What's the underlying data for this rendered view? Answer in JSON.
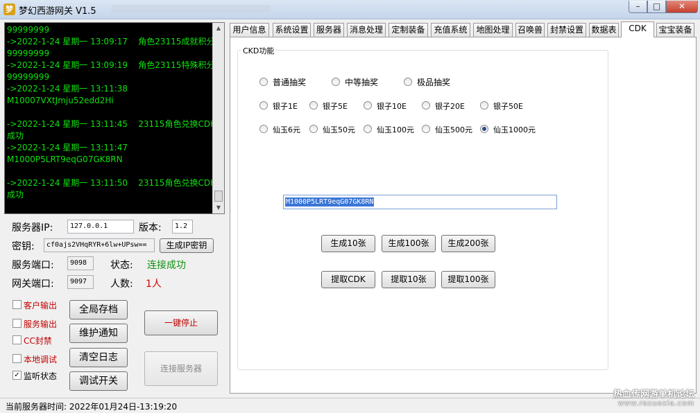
{
  "window": {
    "title": "梦幻西游网关 V1.5",
    "app_icon": "梦"
  },
  "log": {
    "lines": [
      "99999999",
      "->2022-1-24 星期一 13:09:17    角色23115成就积分",
      "99999999",
      "->2022-1-24 星期一 13:09:19    角色23115特殊积分",
      "99999999",
      "->2022-1-24 星期一 13:11:38",
      "M10007VXtJmju52edd2Hi",
      "",
      "->2022-1-24 星期一 13:11:45    23115角色兑换CDK",
      "成功",
      "->2022-1-24 星期一 13:11:47",
      "M1000P5LRT9eqG07GK8RN",
      "",
      "->2022-1-24 星期一 13:11:50    23115角色兑换CDK",
      "成功"
    ]
  },
  "server": {
    "ip_label": "服务器IP:",
    "ip_value": "127.0.0.1",
    "version_label": "版本:",
    "version_value": "1.2",
    "key_label": "密钥:",
    "key_value": "cf0ajs2VHqRYR+6lw+UPsw==",
    "gen_key_button": "生成IP密钥",
    "port_label": "服务端口:",
    "port_value": "9098",
    "gateway_label": "网关端口:",
    "gateway_value": "9097",
    "status_label": "状态:",
    "status_value": "连接成功",
    "count_label": "人数:",
    "count_value": "1人"
  },
  "checkboxes": [
    {
      "label": "客户输出",
      "checked": false,
      "color": "#c00000"
    },
    {
      "label": "服务输出",
      "checked": false,
      "color": "#c00000"
    },
    {
      "label": "CC封禁",
      "checked": false,
      "color": "#c00000"
    },
    {
      "label": "本地调试",
      "checked": false,
      "color": "#c00000"
    },
    {
      "label": "监听状态",
      "checked": true,
      "color": "#000000"
    }
  ],
  "left_buttons": {
    "save_all": "全局存档",
    "maintenance": "维护通知",
    "clear_log": "清空日志",
    "debug_toggle": "调试开关",
    "stop": "一键停止",
    "connect": "连接服务器"
  },
  "tabs": [
    "用户信息",
    "系统设置",
    "服务器",
    "消息处理",
    "定制装备",
    "充值系统",
    "地图处理",
    "召唤兽",
    "封禁设置",
    "数据表",
    "CDK",
    "宝宝装备"
  ],
  "active_tab": "CDK",
  "cdk": {
    "group_title": "CKD功能",
    "lottery": [
      "普通抽奖",
      "中等抽奖",
      "极品抽奖"
    ],
    "silver": [
      "银子1E",
      "银子5E",
      "银子10E",
      "银子20E",
      "银子50E"
    ],
    "jade": [
      "仙玉6元",
      "仙玉50元",
      "仙玉100元",
      "仙玉500元",
      "仙玉1000元"
    ],
    "selected": "仙玉1000元",
    "code_value": "M1000P5LRT9eqG07GK8RN",
    "gen_10": "生成10张",
    "gen_100": "生成100张",
    "gen_200": "生成200张",
    "get_cdk": "提取CDK",
    "get_10": "提取10张",
    "get_100": "提取100张"
  },
  "statusbar": {
    "label": "当前服务器时间:",
    "time": "2022年01月24日-13:19:20"
  },
  "watermark": {
    "line1": "热血传网游单机论坛",
    "line2": "www.rexuexia.com"
  },
  "colors": {
    "log_text": "#10e010",
    "status_ok": "#109010",
    "count": "#d00000",
    "stop_text": "#c00000"
  }
}
